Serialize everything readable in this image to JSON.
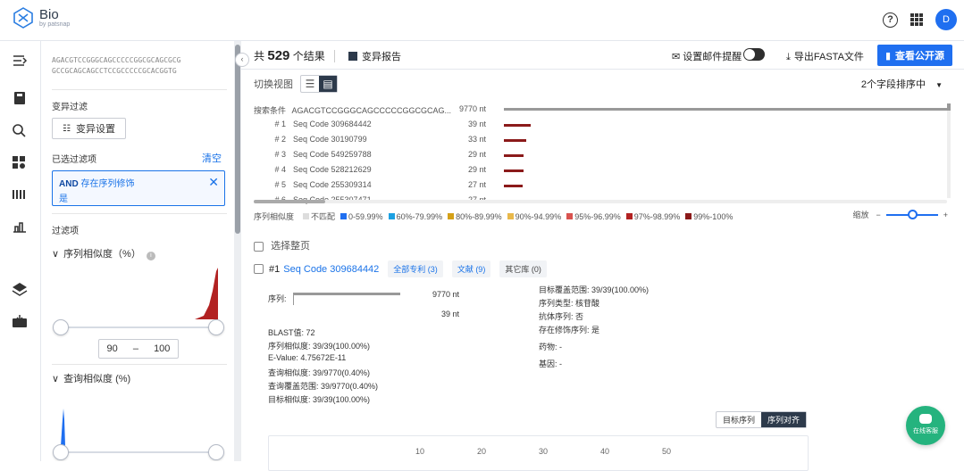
{
  "app": {
    "name": "Bio",
    "sub": "by patsnap",
    "avatar": "D"
  },
  "left": {
    "sequence": [
      "AGACGTCCGGGCAGCCCCCGGCGCAGCGCG",
      "GCCGCAGCAGCCTCCGCCCCCGCACGGTG"
    ],
    "variant_filter_label": "变异过滤",
    "variant_settings_btn": "变异设置",
    "applied_filters_label": "已选过滤项",
    "clear_label": "清空",
    "filter_tag": {
      "prefix": "AND",
      "field": "存在序列修饰",
      "value": "是"
    },
    "filters_label": "过滤项",
    "seq_similarity": {
      "title": "序列相似度（%）",
      "min": "90",
      "sep": "–",
      "max": "100",
      "range_min_frac": 0.0,
      "range_max_frac": 1.0
    },
    "query_similarity": {
      "title": "查询相似度 (%)"
    }
  },
  "main": {
    "total_prefix": "共",
    "total_count": "529",
    "total_suffix": "个结果",
    "variant_report": "变异报告",
    "mail_alert": "设置邮件提醒",
    "export_fasta": "导出FASTA文件",
    "view_public": "查看公开源",
    "switch_view": "切换视图",
    "sort_label": "2个字段排序中",
    "blast": {
      "query_label": "搜索条件",
      "query_seq": "AGACGTCCGGGCAGCCCCCGGCGCAG...",
      "query_len": "9770 nt",
      "hits": [
        {
          "rank": "# 1",
          "code": "Seq Code 309684442",
          "len": "39 nt",
          "value": 39
        },
        {
          "rank": "# 2",
          "code": "Seq Code 30190799",
          "len": "33 nt",
          "value": 33
        },
        {
          "rank": "# 3",
          "code": "Seq Code 549259788",
          "len": "29 nt",
          "value": 29
        },
        {
          "rank": "# 4",
          "code": "Seq Code 528212629",
          "len": "29 nt",
          "value": 29
        },
        {
          "rank": "# 5",
          "code": "Seq Code 255309314",
          "len": "27 nt",
          "value": 27
        },
        {
          "rank": "# 6",
          "code": "Seq Code 255307471",
          "len": "27 nt",
          "value": 27
        }
      ]
    },
    "legend": {
      "label": "序列相似度",
      "items": [
        {
          "text": "不匹配",
          "color": "#dddddd"
        },
        {
          "text": "0-59.99%",
          "color": "#1f6ff0"
        },
        {
          "text": "60%-79.99%",
          "color": "#1ba0e2"
        },
        {
          "text": "80%-89.99%",
          "color": "#d4a017"
        },
        {
          "text": "90%-94.99%",
          "color": "#e8b84a"
        },
        {
          "text": "95%-96.99%",
          "color": "#d9534f"
        },
        {
          "text": "97%-98.99%",
          "color": "#b22222"
        },
        {
          "text": "99%-100%",
          "color": "#8b1a1a"
        }
      ],
      "zoom_label": "缩放",
      "zoom_minus": "−",
      "zoom_plus": "+"
    },
    "select_all": "选择整页",
    "result": {
      "rank": "#1",
      "code": "Seq Code 309684442",
      "chips": [
        "全部专利 (3)",
        "文献 (9)",
        "其它库 (0)"
      ],
      "seq_label": "序列:",
      "query_len": "9770 nt",
      "hit_len": "39 nt",
      "left_fields": [
        "BLAST值: 72",
        "序列相似度: 39/39(100.00%)",
        "E-Value: 4.75672E-11",
        "查询相似度: 39/9770(0.40%)",
        "查询覆盖范围: 39/9770(0.40%)",
        "目标相似度: 39/39(100.00%)"
      ],
      "right_fields": [
        "目标覆盖范围: 39/39(100.00%)",
        "序列类型: 核苷酸",
        "抗体序列: 否",
        "存在修饰序列: 是",
        "药物: -",
        "基因: -"
      ],
      "seg_target": "目标序列",
      "seg_align": "序列对齐",
      "ruler": [
        "10",
        "20",
        "30",
        "40",
        "50"
      ]
    },
    "chat_label": "在线客服"
  }
}
